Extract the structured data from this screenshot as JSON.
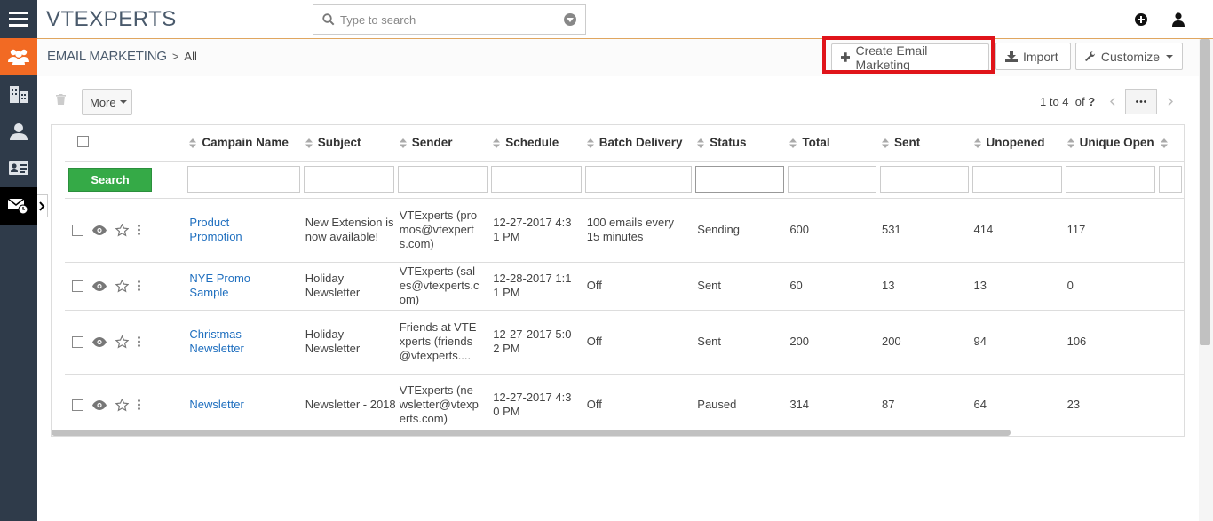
{
  "brand": {
    "logo_pre": "VTE",
    "logo_x": "X",
    "logo_post": "PERTS"
  },
  "search": {
    "placeholder": "Type to search"
  },
  "breadcrumb": {
    "module": "EMAIL MARKETING",
    "separator": ">",
    "view": "All"
  },
  "header_buttons": {
    "create": "Create Email Marketing",
    "import": "Import",
    "customize": "Customize"
  },
  "toolbar": {
    "more": "More"
  },
  "pagination": {
    "range": "1 to 4",
    "of": "of",
    "total": "?"
  },
  "table": {
    "columns": [
      "Campain Name",
      "Subject",
      "Sender",
      "Schedule",
      "Batch Delivery",
      "Status",
      "Total",
      "Sent",
      "Unopened",
      "Unique Open"
    ],
    "search_button": "Search",
    "rows": [
      {
        "name": "Product Promotion",
        "subject": "New Extension is now available!",
        "sender": "VTExperts (promos@vtexperts.com)",
        "schedule": "12-27-2017 4:31 PM",
        "batch": "100 emails every 15 minutes",
        "status": "Sending",
        "total": "600",
        "sent": "531",
        "unopened": "414",
        "unique_open": "117"
      },
      {
        "name": "NYE Promo Sample",
        "subject": "Holiday Newsletter",
        "sender": "VTExperts (sales@vtexperts.com)",
        "schedule": "12-28-2017 1:11 PM",
        "batch": "Off",
        "status": "Sent",
        "total": "60",
        "sent": "13",
        "unopened": "13",
        "unique_open": "0"
      },
      {
        "name": "Christmas Newsletter",
        "subject": "Holiday Newsletter",
        "sender": "Friends at VTExperts (friends@vtexperts....",
        "schedule": "12-27-2017 5:02 PM",
        "batch": "Off",
        "status": "Sent",
        "total": "200",
        "sent": "200",
        "unopened": "94",
        "unique_open": "106"
      },
      {
        "name": "Newsletter",
        "subject": "Newsletter - 2018",
        "sender": "VTExperts (newsletter@vtexperts.com)",
        "schedule": "12-27-2017 4:30 PM",
        "batch": "Off",
        "status": "Paused",
        "total": "314",
        "sent": "87",
        "unopened": "64",
        "unique_open": "23"
      }
    ]
  },
  "colors": {
    "nav_bg": "#2f3b4a",
    "nav_active": "#f26a23",
    "search_green": "#35aa47",
    "highlight_red": "#e0141a",
    "link": "#1f6fbf"
  }
}
